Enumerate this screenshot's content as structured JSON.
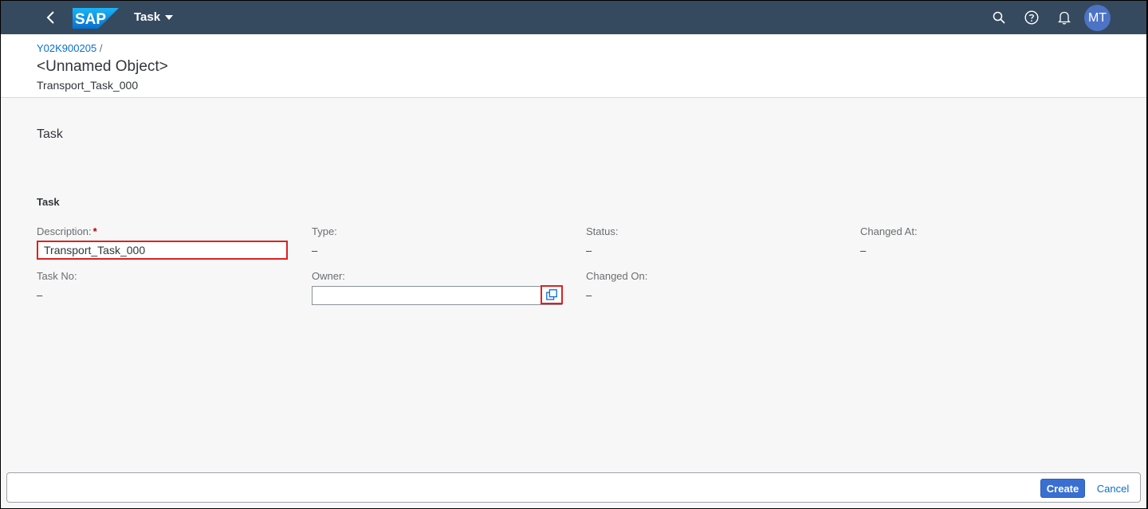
{
  "shell": {
    "logo_text": "SAP",
    "app_title": "Task",
    "user_initials": "MT",
    "icons": [
      "back-icon",
      "search-icon",
      "help-icon",
      "bell-icon"
    ]
  },
  "header": {
    "breadcrumb_link": "Y02K900205",
    "breadcrumb_sep": "/",
    "title": "<Unnamed Object>",
    "subtitle": "Transport_Task_000"
  },
  "section": {
    "title": "Task",
    "group_title": "Task"
  },
  "fields": {
    "description": {
      "label": "Description:",
      "required_mark": "*",
      "value": "Transport_Task_000"
    },
    "type": {
      "label": "Type:",
      "value": "–"
    },
    "status": {
      "label": "Status:",
      "value": "–"
    },
    "changed_at": {
      "label": "Changed At:",
      "value": "–"
    },
    "task_no": {
      "label": "Task No:",
      "value": "–"
    },
    "owner": {
      "label": "Owner:",
      "value": ""
    },
    "changed_on": {
      "label": "Changed On:",
      "value": "–"
    }
  },
  "footer": {
    "create_label": "Create",
    "cancel_label": "Cancel"
  },
  "colors": {
    "shell_bg": "#354a5f",
    "accent": "#0a6ed1",
    "emphasized_button": "#3a6fd2",
    "highlight_border": "#e02020",
    "required": "#bb0000"
  }
}
